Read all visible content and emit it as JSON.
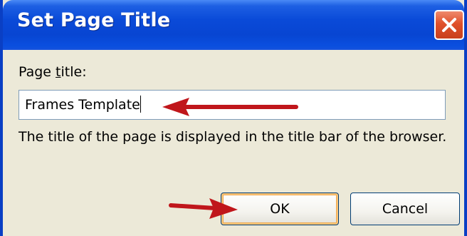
{
  "dialog": {
    "title": "Set Page Title",
    "close_icon": "close-x-icon",
    "field": {
      "label_prefix": "Page ",
      "label_underlined": "t",
      "label_suffix": "itle:",
      "value": "Frames Template"
    },
    "description": "The title of the page is displayed in the title bar of the browser.",
    "buttons": {
      "ok": "OK",
      "cancel": "Cancel"
    }
  },
  "annotations": {
    "arrow_color": "#c0161b",
    "arrows": [
      "arrow-to-title-input",
      "arrow-to-ok-button"
    ]
  },
  "colors": {
    "titlebar": "#0a4ad8",
    "dialog_background": "#ece9d8",
    "close_button": "#e0502a"
  }
}
